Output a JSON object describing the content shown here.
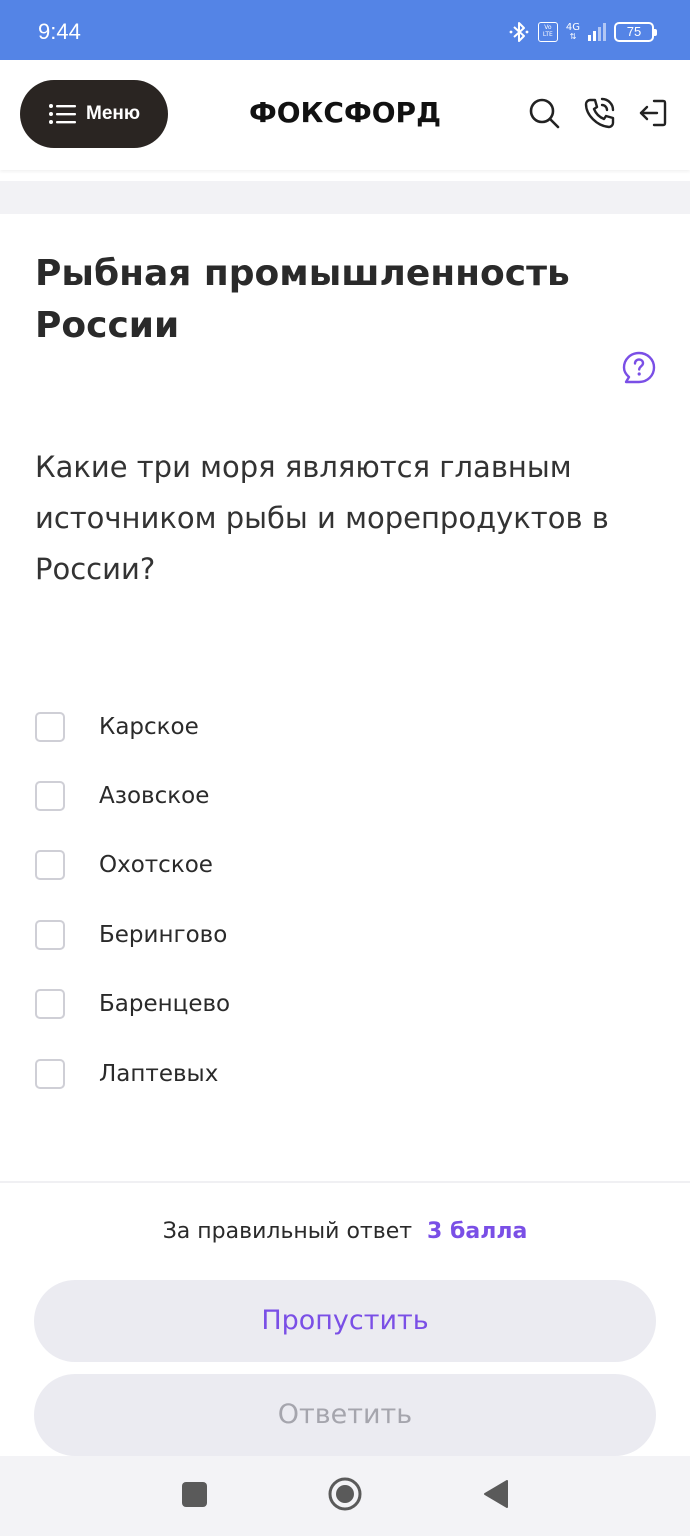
{
  "status_bar": {
    "time": "9:44",
    "network": "4G",
    "volte_top": "Vo",
    "volte_bottom": "LTE",
    "battery": "75"
  },
  "header": {
    "menu_label": "Меню",
    "logo": "ФОКСФОРД",
    "icons": [
      "search-icon",
      "phone-icon",
      "logout-icon"
    ]
  },
  "task": {
    "title": "Рыбная промышленность России",
    "question": "Какие три моря являются главным источником рыбы и морепродуктов в России?",
    "options": [
      {
        "label": "Карское",
        "checked": false
      },
      {
        "label": "Азовское",
        "checked": false
      },
      {
        "label": "Охотское",
        "checked": false
      },
      {
        "label": "Берингово",
        "checked": false
      },
      {
        "label": "Баренцево",
        "checked": false
      },
      {
        "label": "Лаптевых",
        "checked": false
      }
    ]
  },
  "footer": {
    "points_text": "За правильный ответ",
    "points_value": "3 балла",
    "skip_label": "Пропустить",
    "answer_label": "Ответить"
  },
  "colors": {
    "status_bar": "#5484e6",
    "accent": "#7a4fe6",
    "menu_button": "#2a2522",
    "button_bg": "#ebebf1"
  }
}
